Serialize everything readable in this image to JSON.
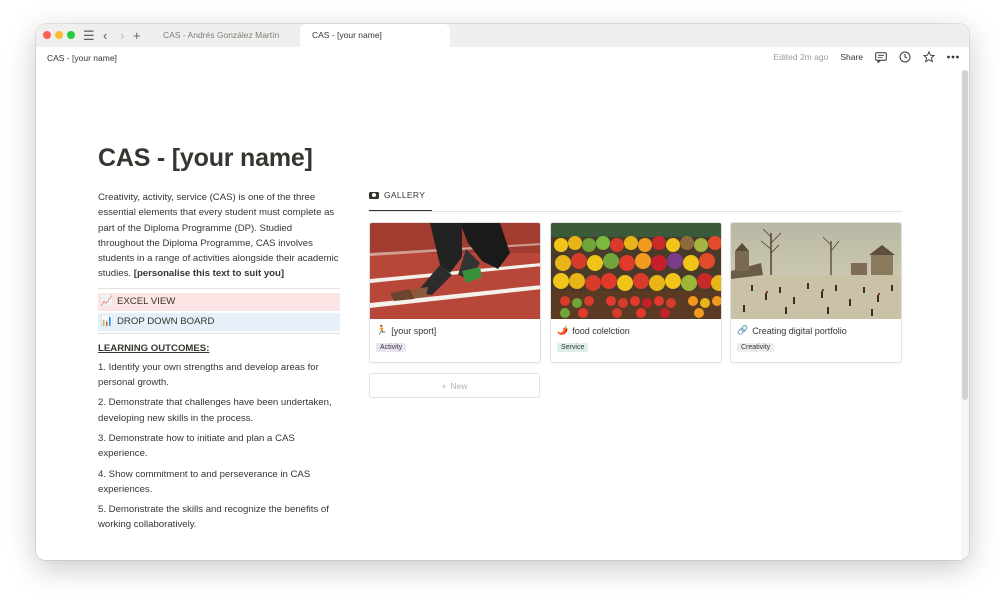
{
  "tabs": [
    {
      "label": "CAS - Andrés González Martín",
      "active": false
    },
    {
      "label": "CAS - [your name]",
      "active": true
    }
  ],
  "topbar": {
    "breadcrumb": "CAS - [your name]",
    "edited": "Edited 2m ago",
    "share_label": "Share"
  },
  "page": {
    "title": "CAS - [your name]",
    "intro_text": "Creativity, activity, service (CAS) is one of the three essential elements that every student must complete as part of the Diploma Programme (DP). Studied throughout the Diploma Programme, CAS involves students in a range of activities alongside their academic studies.",
    "intro_bold": "[personalise this text to suit you]",
    "callouts": [
      {
        "emoji": "📈",
        "label": "EXCEL VIEW",
        "color": "#fbe4e4"
      },
      {
        "emoji": "📊",
        "label": "DROP DOWN BOARD",
        "color": "#e7f0f8"
      }
    ],
    "learning_outcomes_heading": "LEARNING OUTCOMES:",
    "learning_outcomes": [
      "1. Identify your own strengths and develop areas for personal growth.",
      "2. Demonstrate that challenges have been undertaken, developing new skills in the process.",
      "3. Demonstrate how to initiate and plan a CAS experience.",
      "4. Show commitment to and perseverance in CAS experiences.",
      "5. Demonstrate the skills and recognize the benefits of working collaboratively."
    ]
  },
  "gallery": {
    "tab_label": "GALLERY",
    "cards": [
      {
        "icon": "🏃",
        "title": "[your sport]",
        "tag": "Activity"
      },
      {
        "icon": "🌶️",
        "title": "food colelction",
        "tag": "Service"
      },
      {
        "icon": "🔗",
        "title": "Creating digital portfolio",
        "tag": "Creativity"
      }
    ],
    "new_label": "New"
  },
  "help_label": "?"
}
